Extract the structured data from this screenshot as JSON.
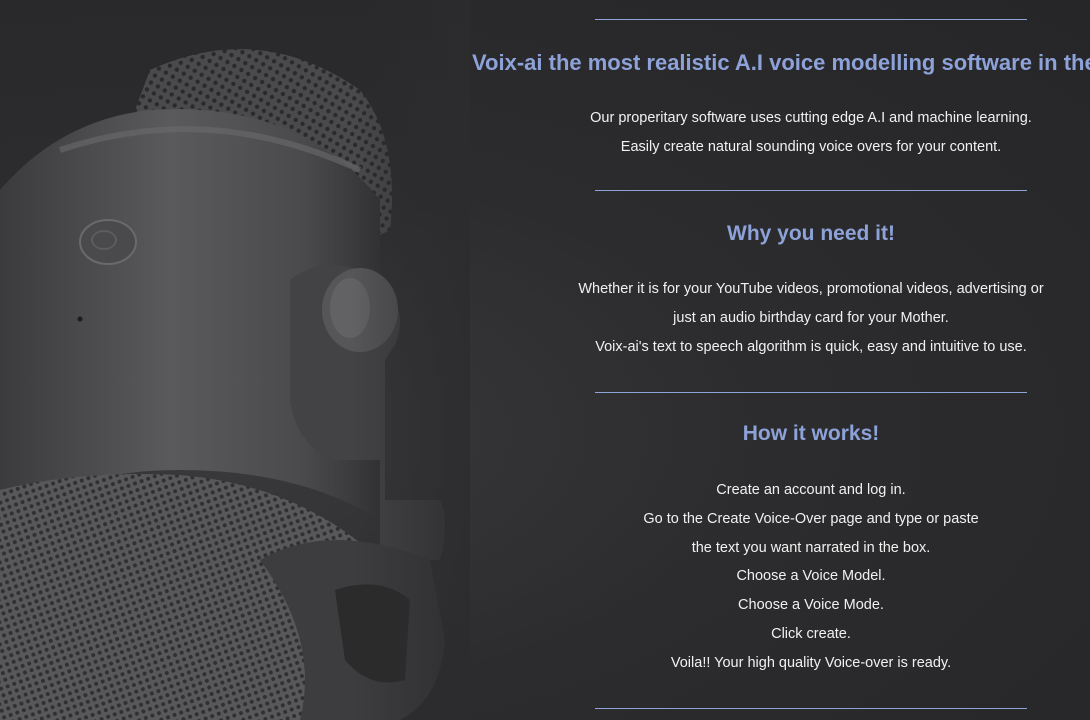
{
  "hero": {
    "title": "Voix-ai the most realistic A.I voice modelling software in the universe",
    "lines": [
      "Our properitary software uses cutting edge A.I and machine learning.",
      "Easily create natural sounding voice overs for your content."
    ]
  },
  "why": {
    "title": "Why you need it!",
    "lines": [
      "Whether it is for your YouTube videos, promotional videos, advertising or",
      "just an audio birthday card for your Mother.",
      "Voix-ai's text to speech algorithm is quick, easy and intuitive to use."
    ]
  },
  "how": {
    "title": "How it works!",
    "steps": [
      "Create an account and log in.",
      "Go to the Create Voice-Over page and type or paste",
      "the text you want narrated in the box.",
      "Choose a Voice Model.",
      "Choose a Voice Mode.",
      "Click create.",
      "Voila!! Your high quality Voice-over is ready."
    ]
  },
  "colors": {
    "heading": "#8da2d8",
    "divider": "#8ea3d6",
    "text": "#f1f1f1",
    "background": "#2c2c2e"
  }
}
